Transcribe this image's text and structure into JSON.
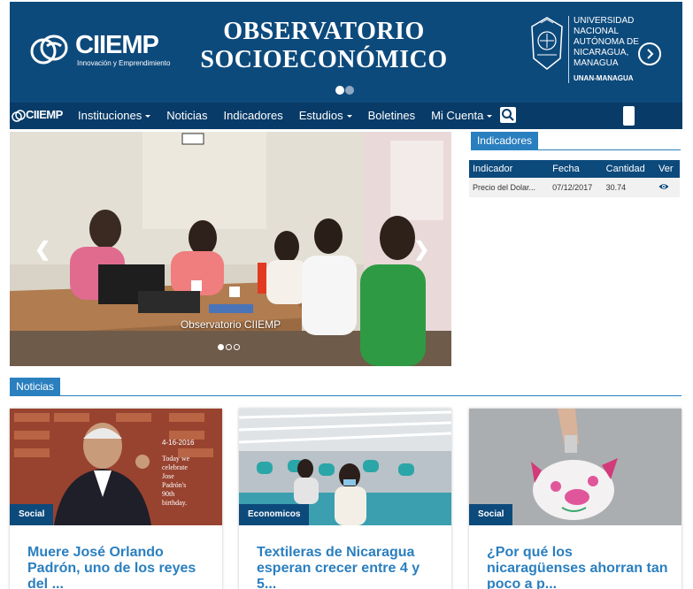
{
  "banner": {
    "logo_text": "CIIEMP",
    "logo_tagline": "Innovación y Emprendimiento",
    "title_line1": "OBSERVATORIO",
    "title_line2": "SOCIOECONÓMICO",
    "university_lines": [
      "UNIVERSIDAD",
      "NACIONAL",
      "AUTÓNOMA DE",
      "NICARAGUA,",
      "MANAGUA"
    ],
    "university_abbr": "UNAN-MANAGUA"
  },
  "nav": {
    "logo_text": "CIIEMP",
    "items": [
      {
        "label": "Instituciones",
        "dropdown": true
      },
      {
        "label": "Noticias",
        "dropdown": false
      },
      {
        "label": "Indicadores",
        "dropdown": false
      },
      {
        "label": "Estudios",
        "dropdown": true
      },
      {
        "label": "Boletines",
        "dropdown": false
      },
      {
        "label": "Mi Cuenta",
        "dropdown": true
      }
    ]
  },
  "carousel": {
    "caption": "Observatorio CIIEMP",
    "slide_count": 3,
    "active_slide": 1
  },
  "indicators": {
    "tab_label": "Indicadores",
    "columns": [
      "Indicador",
      "Fecha",
      "Cantidad",
      "Ver"
    ],
    "rows": [
      {
        "indicador": "Precio del Dolar...",
        "fecha": "07/12/2017",
        "cantidad": "30.74"
      }
    ]
  },
  "news": {
    "tab_label": "Noticias",
    "cards": [
      {
        "category": "Social",
        "title": "Muere José Orlando Padrón, uno de los reyes del ...",
        "image_text": [
          "Today we",
          "celebrate",
          "Jose",
          "Padrón's",
          "90th",
          "birthday."
        ],
        "image_date": "4-16-2016"
      },
      {
        "category": "Economicos",
        "title": "Textileras de Nicaragua esperan crecer entre 4 y 5..."
      },
      {
        "category": "Social",
        "title": "¿Por qué los nicaragüenses ahorran tan poco a p..."
      }
    ]
  },
  "colors": {
    "banner_blue": "#0d4a7c",
    "nav_blue": "#083b68",
    "accent_blue": "#2a7fbf"
  }
}
